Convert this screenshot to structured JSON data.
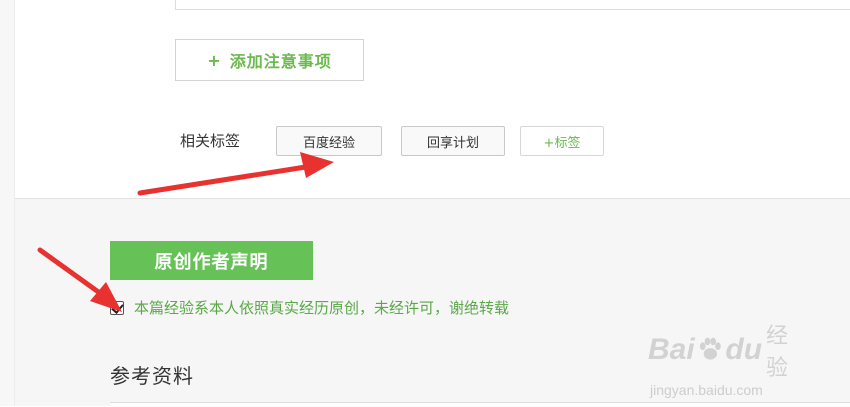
{
  "notes": {
    "add_button_icon": "+",
    "add_button_label": "添加注意事项"
  },
  "tags": {
    "label": "相关标签",
    "items": [
      "百度经验",
      "回享计划"
    ],
    "add_label": "+标签"
  },
  "declaration": {
    "banner": "原创作者声明",
    "checkbox_checked": true,
    "statement": "本篇经验系本人依照真实经历原创，未经许可，谢绝转载"
  },
  "references": {
    "title": "参考资料"
  },
  "watermark": {
    "brand_left": "Bai",
    "brand_right": "du",
    "brand_cn": "经验",
    "url": "jingyan.baidu.com"
  },
  "colors": {
    "accent_green": "#66c157",
    "text_green": "#5aa848",
    "arrow_red": "#e8322f"
  }
}
